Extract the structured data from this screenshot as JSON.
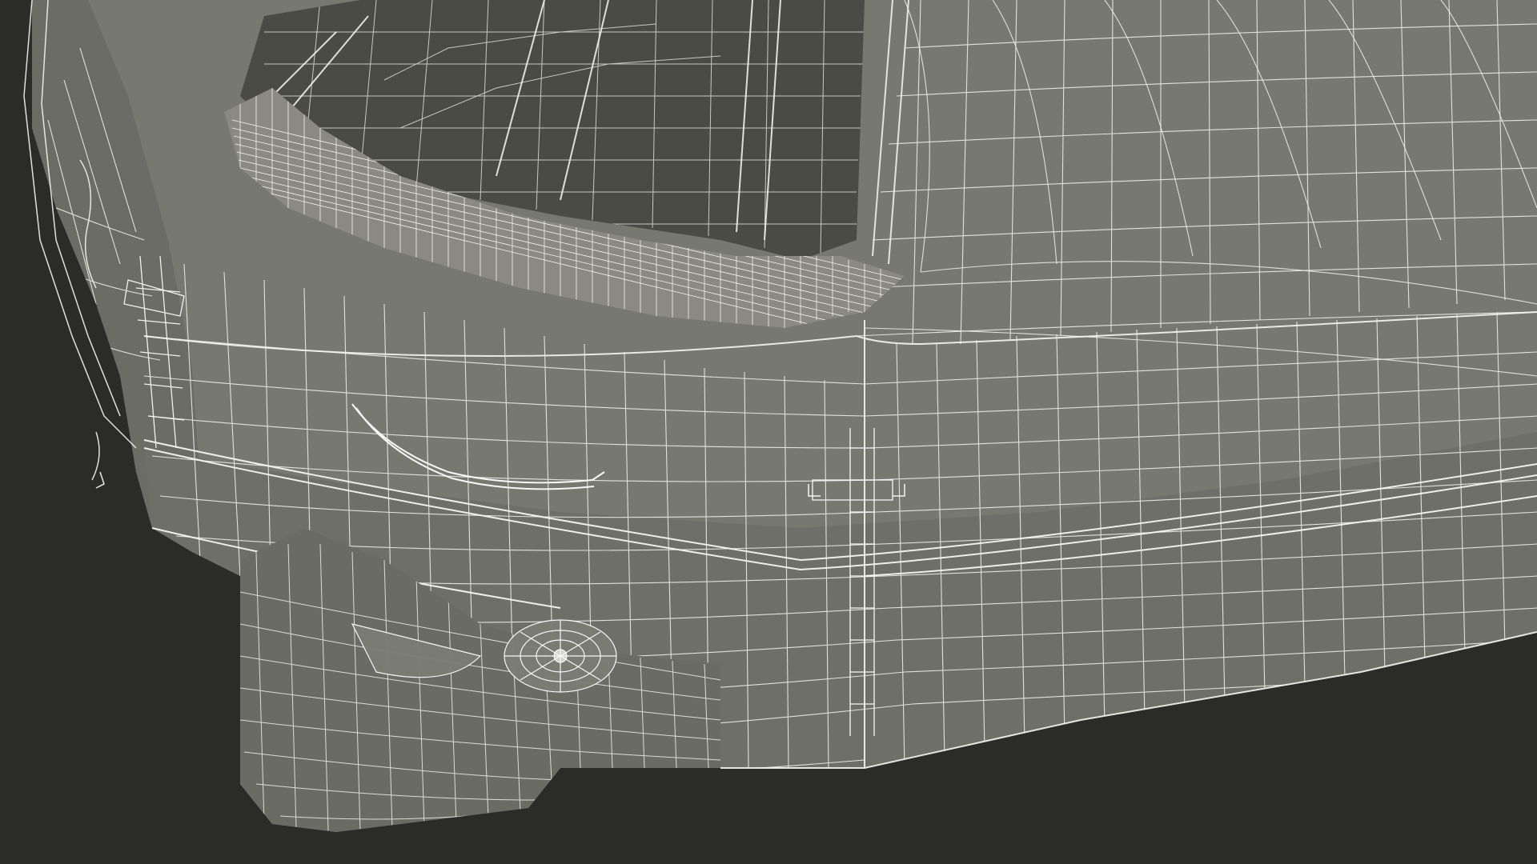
{
  "scene": {
    "subject": "wireframe-vehicle-rear-bumper",
    "background_color": "#2b2b29",
    "surface_color": "#777870",
    "surface_dark_color": "#5d5e57",
    "interior_color": "#4a4b45",
    "wire_color": "#f2f2ec",
    "dense_wire_color": "#ffffff"
  }
}
